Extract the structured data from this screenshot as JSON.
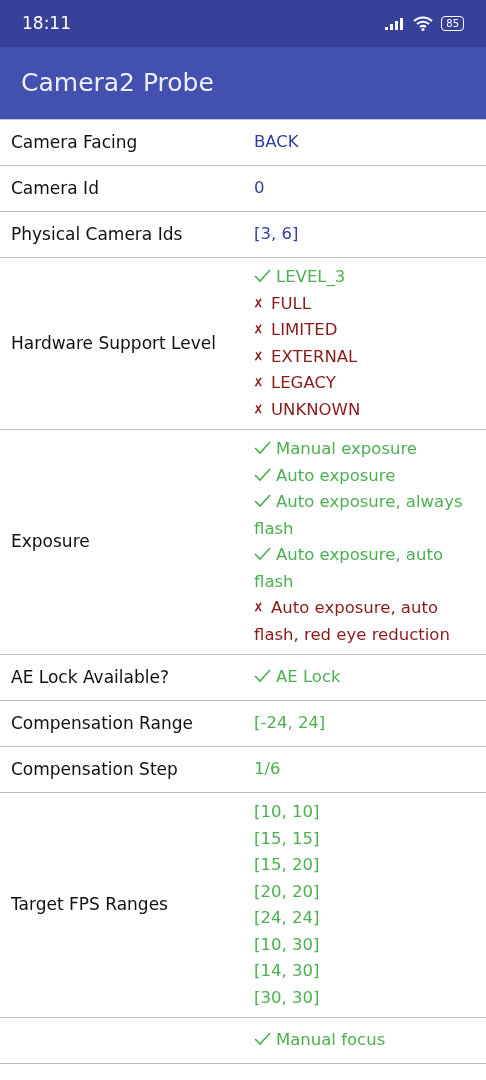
{
  "status_bar": {
    "time": "18:11",
    "battery": "85"
  },
  "app_bar": {
    "title": "Camera2 Probe"
  },
  "rows": [
    {
      "label": "Camera Facing",
      "kind": "info",
      "values": [
        {
          "text": "BACK"
        }
      ]
    },
    {
      "label": "Camera Id",
      "kind": "info",
      "values": [
        {
          "text": "0"
        }
      ]
    },
    {
      "label": "Physical Camera Ids",
      "kind": "info",
      "values": [
        {
          "text": "[3, 6]"
        }
      ]
    },
    {
      "label": "Hardware Support Level",
      "kind": "feature",
      "values": [
        {
          "text": "LEVEL_3",
          "supported": true
        },
        {
          "text": "FULL",
          "supported": false
        },
        {
          "text": "LIMITED",
          "supported": false
        },
        {
          "text": "EXTERNAL",
          "supported": false
        },
        {
          "text": "LEGACY",
          "supported": false
        },
        {
          "text": "UNKNOWN",
          "supported": false
        }
      ]
    },
    {
      "label": "Exposure",
      "kind": "feature",
      "values": [
        {
          "text": "Manual exposure",
          "supported": true
        },
        {
          "text": "Auto exposure",
          "supported": true
        },
        {
          "text": "Auto exposure, always flash",
          "supported": true
        },
        {
          "text": "Auto exposure, auto flash",
          "supported": true
        },
        {
          "text": "Auto exposure, auto flash, red eye reduction",
          "supported": false
        }
      ]
    },
    {
      "label": "AE Lock Available?",
      "kind": "feature",
      "values": [
        {
          "text": "AE Lock",
          "supported": true
        }
      ]
    },
    {
      "label": "Compensation Range",
      "kind": "feature",
      "values": [
        {
          "text": "[-24, 24]"
        }
      ]
    },
    {
      "label": "Compensation Step",
      "kind": "feature",
      "values": [
        {
          "text": "1/6"
        }
      ]
    },
    {
      "label": "Target FPS Ranges",
      "kind": "feature",
      "values": [
        {
          "text": "[10, 10]"
        },
        {
          "text": "[15, 15]"
        },
        {
          "text": "[15, 20]"
        },
        {
          "text": "[20, 20]"
        },
        {
          "text": "[24, 24]"
        },
        {
          "text": "[10, 30]"
        },
        {
          "text": "[14, 30]"
        },
        {
          "text": "[30, 30]"
        }
      ]
    },
    {
      "kind": "feature",
      "values": [
        {
          "text": "Manual focus",
          "supported": true
        }
      ]
    }
  ]
}
